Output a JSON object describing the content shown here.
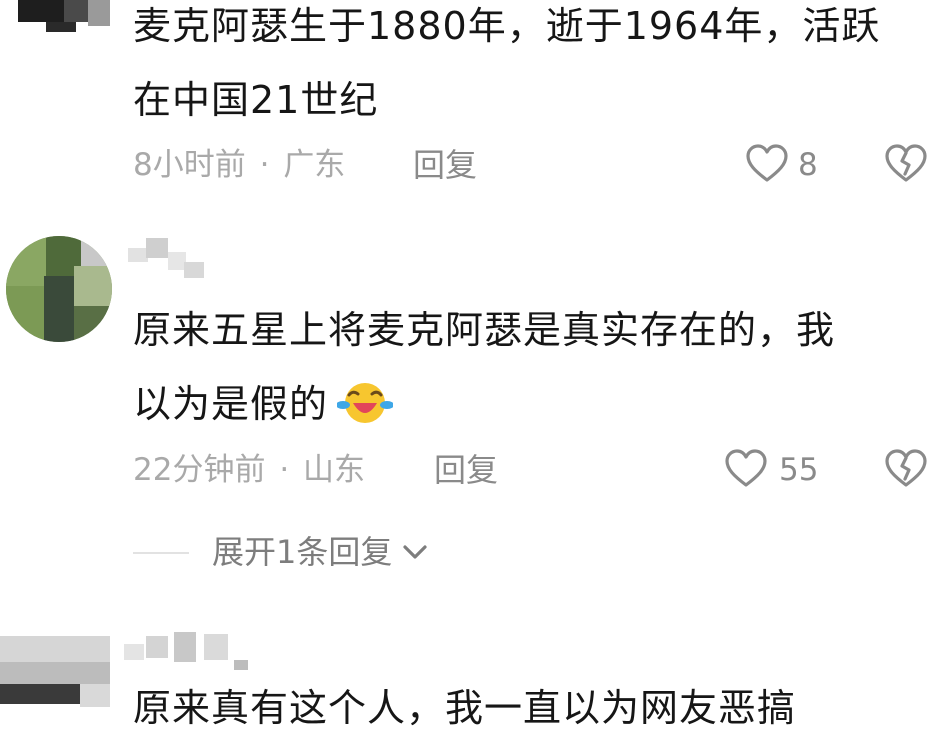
{
  "comments": [
    {
      "text_line1": "麦克阿瑟生于1880年，逝于1964年，活跃",
      "text_line2": "在中国21世纪",
      "time": "8小时前",
      "location": "广东",
      "reply_label": "回复",
      "likes": "8"
    },
    {
      "text_line1": "原来五星上将麦克阿瑟是真实存在的，我",
      "text_line2": "以为是假的",
      "emoji_icon": "laughing-crying-emoji-icon",
      "time": "22分钟前",
      "location": "山东",
      "reply_label": "回复",
      "likes": "55",
      "expand_replies": "展开1条回复"
    },
    {
      "text_partial": "原来真有这个人，我一直以为网友恶搞"
    }
  ],
  "meta_separator": "·",
  "colors": {
    "text": "#161616",
    "meta": "#a9a9a9",
    "icon": "#8a8a8a",
    "emoji_yellow": "#f7c62f",
    "emoji_blue": "#3ea7e7"
  }
}
